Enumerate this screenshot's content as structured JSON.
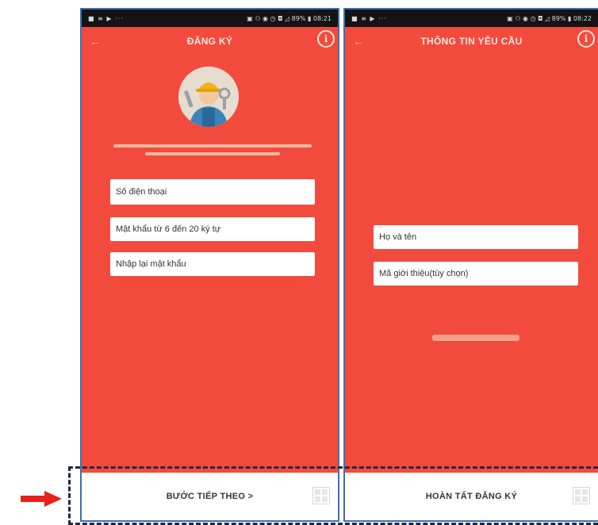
{
  "left_screen": {
    "status_left": "■ ≡ ▶ ···",
    "status_right": "▣ ⚇ ◉ ◷ ◘ ◿ 89% ▮ 08:21",
    "title": "ĐĂNG KÝ",
    "fields": {
      "phone_placeholder": "Số điện thoại",
      "password_placeholder": "Mật khẩu từ 6 đến 20 ký tự",
      "confirm_placeholder": "Nhập lại mật khẩu"
    },
    "next_button": "BƯỚC TIẾP THEO  >"
  },
  "right_screen": {
    "status_left": "■ ≡ ▶ ···",
    "status_right": "▣ ⚇ ◉ ◷ ◘ ◿ 89% ▮ 08:22",
    "title": "THÔNG TIN YÊU CẦU",
    "fields": {
      "name_placeholder": "Họ và tên",
      "referral_placeholder": "Mã giới thiệu(tùy chọn)"
    },
    "finish_button": "HOÀN TẤT ĐĂNG KÝ"
  },
  "icons": {
    "back": "arrow-left-icon",
    "info": "info-icon",
    "grid": "grid-icon",
    "pointer": "red-arrow-icon"
  },
  "colors": {
    "screen_background": "#f24b3d",
    "bottom_bar": "#ffffff",
    "frame_border": "#3d6fb5",
    "highlight_dash": "#1e2a44",
    "pointer_arrow": "#e8211b"
  }
}
